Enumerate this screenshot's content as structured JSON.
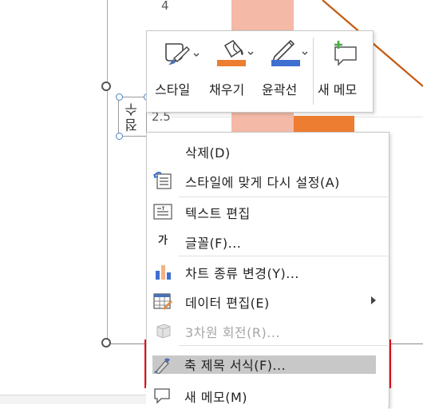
{
  "chart": {
    "tick_top": "4",
    "tick_mid": "2.5",
    "axis_title": "점수",
    "colors": {
      "bar_light": "#f4b9a7",
      "bar_orange": "#ed7d31",
      "line": "#c55a11"
    }
  },
  "mini_toolbar": {
    "style_label": "스타일",
    "fill_label": "채우기",
    "outline_label": "윤곽선",
    "new_memo_label": "새 메모",
    "fill_color": "#ed7d31",
    "outline_color": "#3f6fd0"
  },
  "context_menu": {
    "items": [
      {
        "label": "삭제(D)",
        "icon": "none",
        "disabled": false
      },
      {
        "label": "스타일에 맞게 다시 설정(A)",
        "icon": "reset-style-icon",
        "disabled": false
      },
      {
        "label": "텍스트 편집",
        "icon": "edit-text-icon",
        "disabled": false
      },
      {
        "label": "글꼴(F)...",
        "icon": "font-icon",
        "icon_text": "가",
        "disabled": false
      },
      {
        "label": "차트 종류 변경(Y)...",
        "icon": "chart-type-icon",
        "disabled": false
      },
      {
        "label": "데이터 편집(E)",
        "icon": "edit-data-icon",
        "disabled": false,
        "submenu": true
      },
      {
        "label": "3차원 회전(R)...",
        "icon": "3d-rotation-icon",
        "disabled": true
      },
      {
        "label": "축 제목 서식(F)...",
        "icon": "format-axis-title-icon",
        "disabled": false,
        "highlighted": true
      },
      {
        "label": "새 메모(M)",
        "icon": "new-memo-icon",
        "disabled": false
      }
    ]
  },
  "highlight_color": "#e8131c"
}
